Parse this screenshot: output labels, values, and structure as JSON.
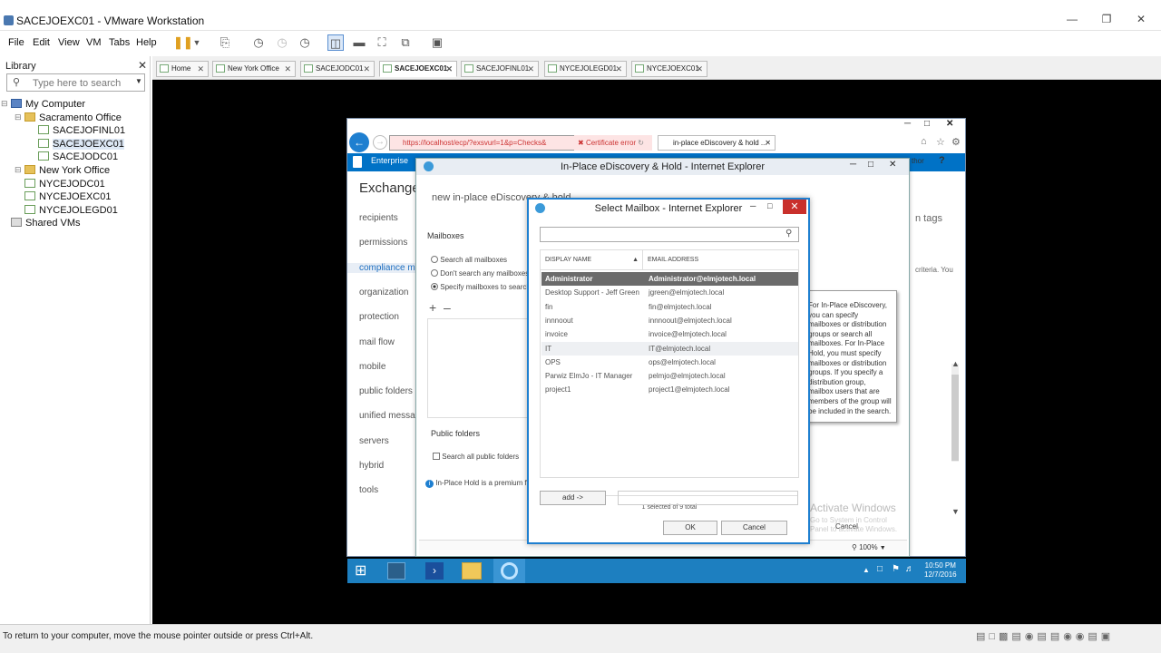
{
  "window": {
    "title": "SACEJOEXC01 - VMware Workstation"
  },
  "menu": [
    "File",
    "Edit",
    "View",
    "VM",
    "Tabs",
    "Help"
  ],
  "library": {
    "title": "Library",
    "search_placeholder": "Type here to search",
    "tree": [
      {
        "label": "My Computer",
        "type": "pc",
        "level": 0
      },
      {
        "label": "Sacramento Office",
        "type": "folder",
        "level": 1
      },
      {
        "label": "SACEJOFINL01",
        "type": "vm",
        "level": 2
      },
      {
        "label": "SACEJOEXC01",
        "type": "vm",
        "level": 2,
        "selected": true
      },
      {
        "label": "SACEJODC01",
        "type": "vm",
        "level": 2
      },
      {
        "label": "New York Office",
        "type": "folder",
        "level": 1
      },
      {
        "label": "NYCEJODC01",
        "type": "vm",
        "level": 1
      },
      {
        "label": "NYCEJOEXC01",
        "type": "vm",
        "level": 1
      },
      {
        "label": "NYCEJOLEGD01",
        "type": "vm",
        "level": 1
      },
      {
        "label": "Shared VMs",
        "type": "shared",
        "level": 0
      }
    ]
  },
  "tabs": [
    {
      "label": "Home"
    },
    {
      "label": "New York Office"
    },
    {
      "label": "SACEJODC01"
    },
    {
      "label": "SACEJOEXC01",
      "active": true
    },
    {
      "label": "SACEJOFINL01"
    },
    {
      "label": "NYCEJOLEGD01"
    },
    {
      "label": "NYCEJOEXC01"
    }
  ],
  "ie_outer": {
    "address": "https://localhost/ecp/?exsvurl=1&p=Checks&",
    "cert_error": "Certificate error",
    "tab_label": "in-place eDiscovery & hold ...",
    "enterprise": "Enterprise",
    "exchange": "Exchange",
    "nav": [
      "recipients",
      "permissions",
      "compliance m",
      "organization",
      "protection",
      "mail flow",
      "mobile",
      "public folders",
      "unified messag",
      "servers",
      "hybrid",
      "tools"
    ],
    "right_tags": "n tags",
    "right_criteria": "criteria. You",
    "author": "thor",
    "help": "?"
  },
  "ediscovery": {
    "title": "In-Place eDiscovery & Hold - Internet Explorer",
    "heading": "new in-place eDiscovery & hold",
    "mailboxes_label": "Mailboxes",
    "options": [
      "Search all mailboxes",
      "Don't search any mailboxes",
      "Specify mailboxes to search"
    ],
    "public_folders_label": "Public folders",
    "search_public_folders": "Search all public folders",
    "info": "In-Place Hold is a premium f",
    "tooltip": "For In-Place eDiscovery, you can specify mailboxes or distribution groups or search all mailboxes. For In-Place Hold, you must specify mailboxes or distribution groups. If you specify a distribution group, mailbox users that are members of the group will be included in the search.",
    "cancel": "Cancel",
    "activate_title": "Activate Windows",
    "activate_sub": "Go to System in Control Panel to activate Windows.",
    "zoom": "100%"
  },
  "dialog": {
    "title": "Select Mailbox - Internet Explorer",
    "columns": {
      "display_name": "DISPLAY NAME",
      "email": "EMAIL ADDRESS"
    },
    "rows": [
      {
        "name": "Administrator",
        "email": "Administrator@elmjotech.local",
        "selected": true
      },
      {
        "name": "Desktop Support - Jeff Green",
        "email": "jgreen@elmjotech.local"
      },
      {
        "name": "fin",
        "email": "fin@elmjotech.local"
      },
      {
        "name": "innnoout",
        "email": "innnoout@elmjotech.local"
      },
      {
        "name": "invoice",
        "email": "invoice@elmjotech.local"
      },
      {
        "name": "IT",
        "email": "IT@elmjotech.local",
        "hover": true
      },
      {
        "name": "OPS",
        "email": "ops@elmjotech.local"
      },
      {
        "name": "Parwiz ElmJo - IT Manager",
        "email": "pelmjo@elmjotech.local"
      },
      {
        "name": "project1",
        "email": "project1@elmjotech.local"
      }
    ],
    "status": "1 selected of 9 total",
    "add_label": "add ->",
    "ok": "OK",
    "cancel": "Cancel"
  },
  "clock": {
    "time": "10:50 PM",
    "date": "12/7/2016"
  },
  "statusbar": "To return to your computer, move the mouse pointer outside or press Ctrl+Alt.",
  "colors": {
    "selected_row": "#6b6b6b",
    "o365_blue": "#0072c6",
    "taskbar": "#1d7fc0",
    "dialog_border": "#1e7fd0"
  }
}
